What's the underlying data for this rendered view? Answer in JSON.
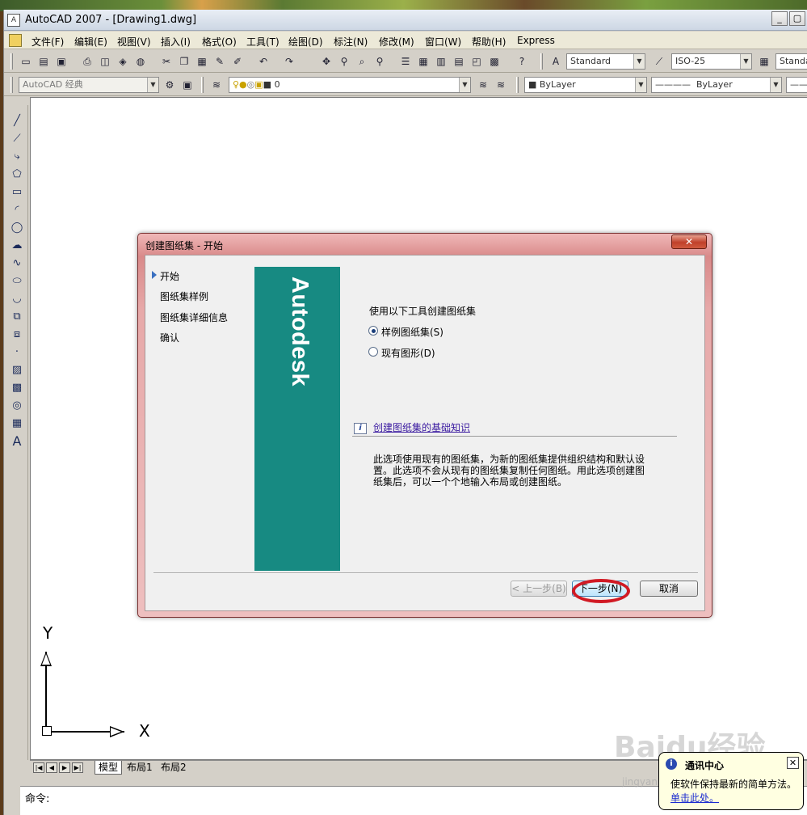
{
  "window": {
    "title": "AutoCAD 2007 - [Drawing1.dwg]"
  },
  "menu": [
    "文件(F)",
    "编辑(E)",
    "视图(V)",
    "插入(I)",
    "格式(O)",
    "工具(T)",
    "绘图(D)",
    "标注(N)",
    "修改(M)",
    "窗口(W)",
    "帮助(H)",
    "Express"
  ],
  "toolbar": {
    "text_style": "Standard",
    "dim_style": "ISO-25",
    "table_style": "Standa",
    "workspace": "AutoCAD 经典",
    "layer": "0",
    "color": "ByLayer",
    "linetype": "ByLayer"
  },
  "dialog": {
    "title": "创建图纸集 - 开始",
    "close": "✕",
    "steps": [
      "开始",
      "图纸集样例",
      "图纸集详细信息",
      "确认"
    ],
    "brand": "Autodesk",
    "heading": "使用以下工具创建图纸集",
    "option_example": "样例图纸集(S)",
    "option_existing": "现有图形(D)",
    "info_icon": "i",
    "help_link": "创建图纸集的基础知识",
    "description": "此选项使用现有的图纸集，为新的图纸集提供组织结构和默认设置。此选项不会从现有的图纸集复制任何图纸。用此选项创建图纸集后，可以一个个地输入布局或创建图纸。",
    "back": "< 上一步(B)",
    "next": "下一步(N)",
    "cancel": "取消"
  },
  "ucs": {
    "x": "X",
    "y": "Y"
  },
  "layout_tabs": [
    "模型",
    "布局1",
    "布局2"
  ],
  "command": {
    "prompt": "命令:"
  },
  "comm_center": {
    "title": "通讯中心",
    "message": "使软件保持最新的简单方法。",
    "link": "单击此处。"
  },
  "watermark": {
    "main": "Baidu经验",
    "sub": "jingyan.baidu.com"
  },
  "colors": {
    "banner": "#178a82",
    "highlight": "#d11a24",
    "dialog_frame": "#d98a8a"
  }
}
